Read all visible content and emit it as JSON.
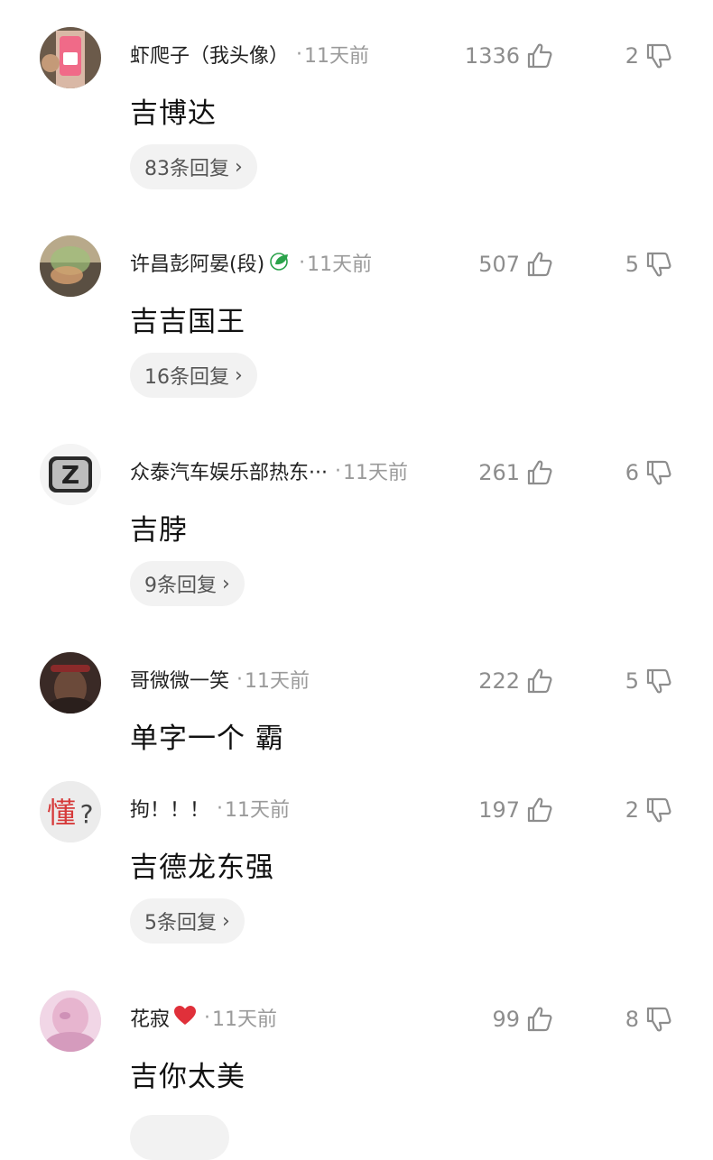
{
  "comments": [
    {
      "username": "虾爬子（我头像）",
      "badge": "",
      "time": "11天前",
      "text": "吉博达",
      "likes": "1336",
      "dislikes": "2",
      "replies": "83条回复"
    },
    {
      "username": "许昌彭阿晏(段)",
      "badge": "🍃",
      "time": "11天前",
      "text": "吉吉国王",
      "likes": "507",
      "dislikes": "5",
      "replies": "16条回复"
    },
    {
      "username": "众泰汽车娱乐部热东···",
      "badge": "",
      "time": "11天前",
      "text": "吉脖",
      "likes": "261",
      "dislikes": "6",
      "replies": "9条回复"
    },
    {
      "username": "哥微微一笑",
      "badge": "",
      "time": "11天前",
      "text": "单字一个  霸",
      "likes": "222",
      "dislikes": "5",
      "replies": ""
    },
    {
      "username": "拘！！！",
      "badge": "",
      "time": "11天前",
      "text": "吉德龙东强",
      "likes": "197",
      "dislikes": "2",
      "replies": "5条回复"
    },
    {
      "username": "花寂",
      "badge": "❤",
      "time": "11天前",
      "text": "吉你太美",
      "likes": "99",
      "dislikes": "8",
      "replies": ""
    }
  ],
  "separator_dot": "·",
  "chevron": "›",
  "avatar_texts": {
    "c4_char": "懂",
    "c4_mark": "?",
    "c2_letter": "Z"
  },
  "colors": {
    "muted": "#9a9a9a",
    "pill_bg": "#f2f2f2",
    "heart": "#e0303a",
    "leaf": "#2aa24a"
  }
}
